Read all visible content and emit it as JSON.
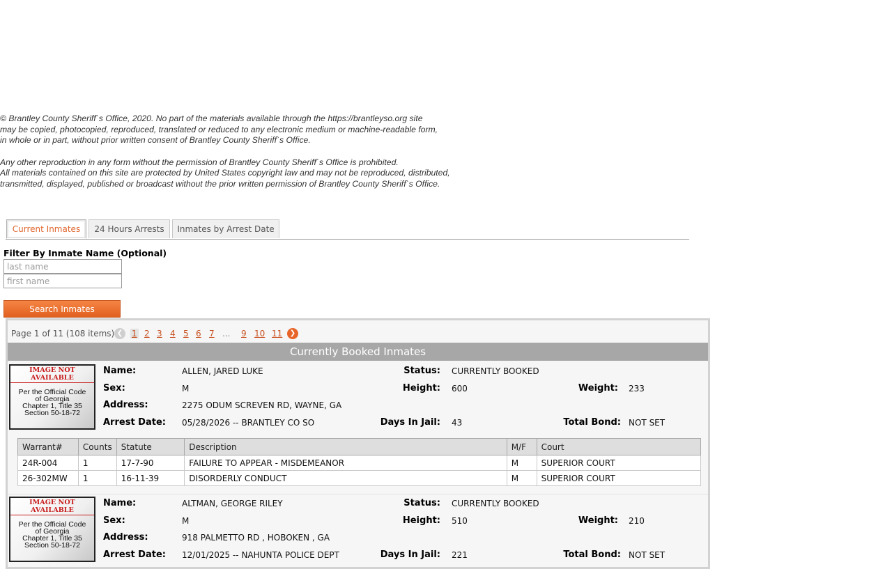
{
  "copyright": {
    "paragraph1": [
      "© Brantley County Sheriff`s Office, 2020. No part of the materials available through the https://brantleyso.org site",
      "may be copied, photocopied, reproduced, translated or reduced to any electronic medium or machine-readable form,",
      "in whole or in part, without prior written consent of Brantley County Sheriff`s Office."
    ],
    "paragraph2": [
      "Any other reproduction in any form without the permission of Brantley County Sheriff`s Office is prohibited.",
      "All materials contained on this site are protected by United States copyright law and may not be reproduced, distributed,",
      "transmitted, displayed, published or broadcast without the prior written permission of Brantley County Sheriff`s Office."
    ]
  },
  "tabs": [
    {
      "label": "Current Inmates",
      "active": true
    },
    {
      "label": "24 Hours Arrests",
      "active": false
    },
    {
      "label": "Inmates by Arrest Date",
      "active": false
    }
  ],
  "filter": {
    "title": "Filter By Inmate Name (Optional)",
    "last_name_placeholder": "last name",
    "first_name_placeholder": "first name",
    "search_label": "Search Inmates"
  },
  "pager": {
    "info": "Page 1 of 11 (108 items)",
    "pages": [
      "1",
      "2",
      "3",
      "4",
      "5",
      "6",
      "7"
    ],
    "ellipsis": "...",
    "tail_pages": [
      "9",
      "10",
      "11"
    ],
    "current_page": "1",
    "prev_icon": "chevron-left-icon",
    "next_icon": "chevron-right-icon"
  },
  "grid_title": "Currently Booked Inmates",
  "photo_placeholder": {
    "title": "IMAGE NOT AVAILABLE",
    "lines": [
      "Per the Official Code",
      "of Georgia",
      "Chapter 1, Title 35",
      "Section 50-18-72"
    ]
  },
  "labels": {
    "name": "Name:",
    "status": "Status:",
    "sex": "Sex:",
    "height": "Height:",
    "weight": "Weight:",
    "address": "Address:",
    "arrest_date": "Arrest Date:",
    "days_in_jail": "Days In Jail:",
    "total_bond": "Total Bond:"
  },
  "charge_columns": [
    "Warrant#",
    "Counts",
    "Statute",
    "Description",
    "M/F",
    "Court"
  ],
  "inmates": [
    {
      "name": "ALLEN, JARED LUKE",
      "status": "CURRENTLY BOOKED",
      "sex": "M",
      "height": "600",
      "weight": "233",
      "address": "2275 ODUM SCREVEN RD, WAYNE, GA",
      "arrest_date": "05/28/2026 -- BRANTLEY CO SO",
      "days_in_jail": "43",
      "total_bond": "NOT SET",
      "charges": [
        [
          "24R-004",
          "1",
          "17-7-90",
          "FAILURE TO APPEAR - MISDEMEANOR",
          "M",
          "SUPERIOR COURT"
        ],
        [
          "26-302MW",
          "1",
          "16-11-39",
          "DISORDERLY CONDUCT",
          "M",
          "SUPERIOR COURT"
        ]
      ]
    },
    {
      "name": "ALTMAN, GEORGE RILEY",
      "status": "CURRENTLY BOOKED",
      "sex": "M",
      "height": "510",
      "weight": "210",
      "address": "918 PALMETTO RD , HOBOKEN , GA",
      "arrest_date": "12/01/2025 -- NAHUNTA POLICE DEPT",
      "days_in_jail": "221",
      "total_bond": "NOT SET",
      "charges": []
    }
  ]
}
